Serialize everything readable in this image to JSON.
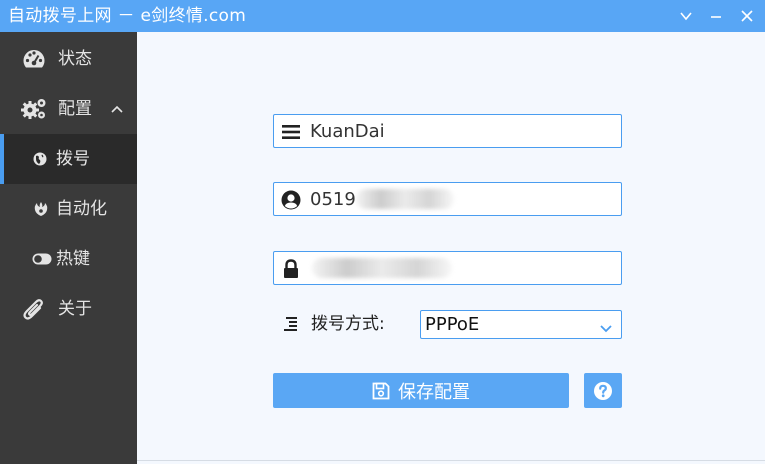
{
  "window": {
    "title": "自动拨号上网 － e剑终情.com",
    "controls": [
      "chevron-down-icon",
      "minimize-icon",
      "close-icon"
    ]
  },
  "sidebar": {
    "items": [
      {
        "label": "状态",
        "icon": "dashboard-icon"
      },
      {
        "label": "配置",
        "icon": "gears-icon",
        "expanded": true
      },
      {
        "label": "拨号",
        "icon": "globe-icon",
        "active": true
      },
      {
        "label": "自动化",
        "icon": "rebel-icon"
      },
      {
        "label": "热键",
        "icon": "toggle-icon"
      },
      {
        "label": "关于",
        "icon": "paperclip-icon"
      }
    ]
  },
  "form": {
    "connection_name": {
      "value": "KuanDai",
      "icon": "bars-icon"
    },
    "username": {
      "value": "0519",
      "icon": "user-circle-icon",
      "note": "remaining digits blurred"
    },
    "password": {
      "value": "",
      "icon": "lock-icon",
      "note": "blurred"
    },
    "dial_method": {
      "label": "拨号方式:",
      "icon": "indent-icon",
      "selected": "PPPoE"
    },
    "save_label": "保存配置",
    "save_icon": "floppy-disk-icon",
    "help_icon": "question-circle-icon"
  },
  "colors": {
    "accent": "#58a6f5",
    "sidebar_bg": "#3a3a3a",
    "sidebar_active": "#2a2a2a",
    "main_bg": "#f4f8fe",
    "border": "#4a9df0"
  }
}
